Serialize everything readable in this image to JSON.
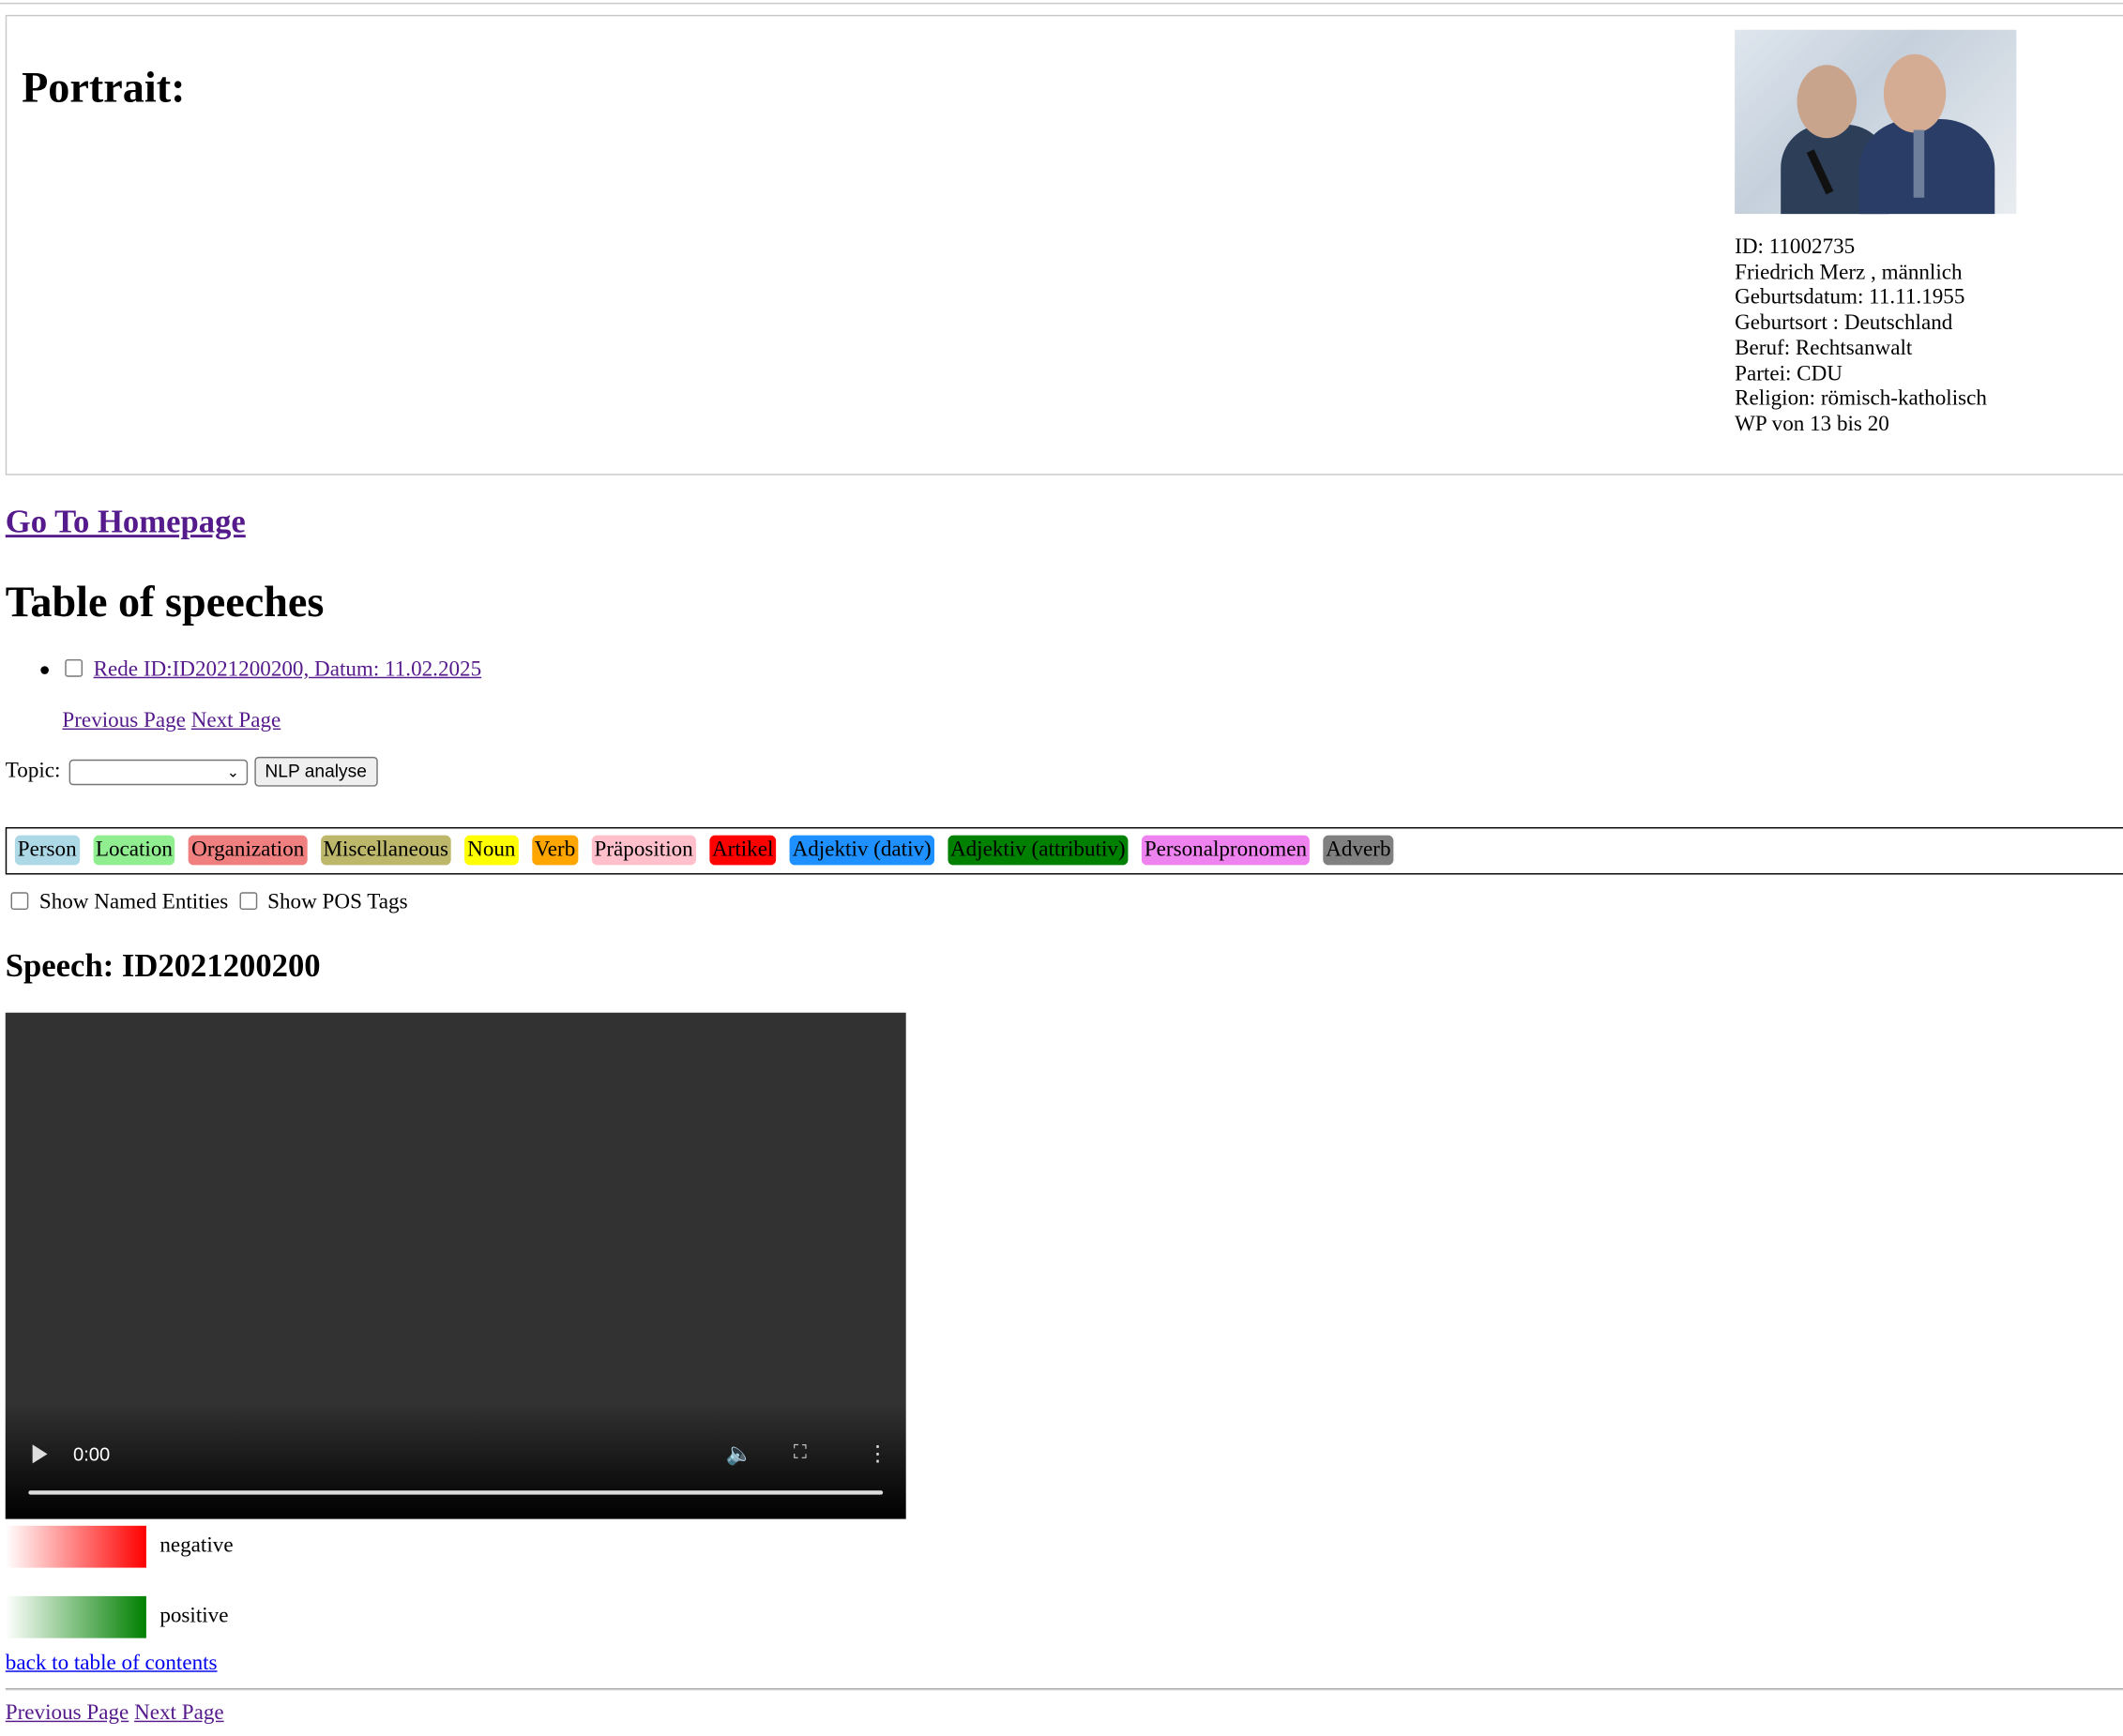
{
  "portrait": {
    "title": "Portrait:",
    "photo": "speaker-photo",
    "info": [
      "ID: 11002735",
      "Friedrich Merz , männlich",
      "Geburtsdatum: 11.11.1955",
      "Geburtsort : Deutschland",
      "Beruf: Rechtsanwalt",
      "Partei: CDU",
      "Religion: römisch-katholisch",
      "WP von 13 bis 20"
    ]
  },
  "nav": {
    "home_link": "Go To Homepage"
  },
  "toc": {
    "title": "Table of speeches",
    "items": [
      {
        "label": "Rede ID:ID2021200200, Datum: 11.02.2025",
        "checked": false
      }
    ],
    "prev_label": "Previous Page",
    "next_label": "Next Page"
  },
  "topic": {
    "label": "Topic:",
    "selected": "",
    "button_label": "NLP analyse"
  },
  "legend": [
    {
      "label": "Person",
      "color": "#add8e6",
      "text_color": "#000000"
    },
    {
      "label": "Location",
      "color": "#90ee90",
      "text_color": "#000000"
    },
    {
      "label": "Organization",
      "color": "#f08080",
      "text_color": "#000000"
    },
    {
      "label": "Miscellaneous",
      "color": "#bdb76b",
      "text_color": "#000000"
    },
    {
      "label": "Noun",
      "color": "#ffff00",
      "text_color": "#000000"
    },
    {
      "label": "Verb",
      "color": "#ffa500",
      "text_color": "#000000"
    },
    {
      "label": "Präposition",
      "color": "#ffc0cb",
      "text_color": "#000000"
    },
    {
      "label": "Artikel",
      "color": "#ff0000",
      "text_color": "#000000"
    },
    {
      "label": "Adjektiv (dativ)",
      "color": "#1e90ff",
      "text_color": "#000000"
    },
    {
      "label": "Adjektiv (attributiv)",
      "color": "#008000",
      "text_color": "#000000"
    },
    {
      "label": "Personalpronomen",
      "color": "#ee82ee",
      "text_color": "#000000"
    },
    {
      "label": "Adverb",
      "color": "#808080",
      "text_color": "#000000"
    }
  ],
  "toggles": {
    "named_entities": {
      "label": "Show Named Entities",
      "checked": false
    },
    "pos_tags": {
      "label": "Show POS Tags",
      "checked": false
    }
  },
  "speech": {
    "title": "Speech: ID2021200200",
    "video": {
      "time": "0:00",
      "progress": 0
    }
  },
  "sentiment": {
    "negative": {
      "label": "negative",
      "color": "#ff0000"
    },
    "positive": {
      "label": "positive",
      "color": "#008000"
    }
  },
  "footer": {
    "back_label": "back to table of contents",
    "prev_label": "Previous Page",
    "next_label": "Next Page"
  }
}
